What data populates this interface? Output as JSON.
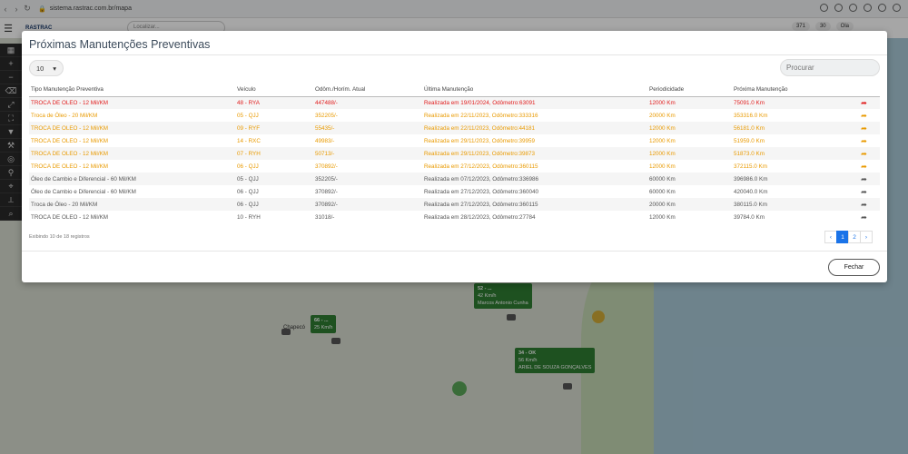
{
  "browser": {
    "url": "sistema.rastrac.com.br/mapa"
  },
  "header": {
    "logo": "RASTRAC",
    "search_placeholder": "Localizar...",
    "badges": [
      "371",
      "30",
      "Ola"
    ]
  },
  "map": {
    "markers": [
      {
        "plate": "52 - ...",
        "speed": "42 Km/h",
        "driver": "Marcos Antonio Cunha"
      },
      {
        "plate": "66 - ...",
        "speed": "25 Km/h",
        "driver": ""
      },
      {
        "plate": "34 - OK",
        "speed": "56 Km/h",
        "driver": "ARIEL DE SOUZA GONÇALVES"
      }
    ],
    "city_label": "Chapecó"
  },
  "modal": {
    "title": "Próximas Manutenções Preventivas",
    "page_size": "10",
    "search_placeholder": "Procurar",
    "columns": [
      "Tipo Manutenção Preventiva",
      "Veículo",
      "Odôm./Horím. Atual",
      "Última Manutenção",
      "Periodicidade",
      "Próxima Manutenção"
    ],
    "rows": [
      {
        "tipo": "TROCA DE OLEO - 12 Mil/KM",
        "veiculo": "48 - RYA",
        "odometro": "447488/-",
        "ultima": "Realizada em 19/01/2024, Odômetro:63091",
        "periodicidade": "12000 Km",
        "proxima": "75091.0 Km",
        "status": "red"
      },
      {
        "tipo": "Troca de Óleo - 20 Mil/KM",
        "veiculo": "05 - QJJ",
        "odometro": "352205/-",
        "ultima": "Realizada em 22/11/2023, Odômetro:333316",
        "periodicidade": "20000 Km",
        "proxima": "353316.0 Km",
        "status": "orange"
      },
      {
        "tipo": "TROCA DE OLEO - 12 Mil/KM",
        "veiculo": "09 - RYF",
        "odometro": "55435/-",
        "ultima": "Realizada em 22/11/2023, Odômetro:44181",
        "periodicidade": "12000 Km",
        "proxima": "56181.0 Km",
        "status": "orange"
      },
      {
        "tipo": "TROCA DE OLEO - 12 Mil/KM",
        "veiculo": "14 - RXC",
        "odometro": "49983/-",
        "ultima": "Realizada em 29/11/2023, Odômetro:39959",
        "periodicidade": "12000 Km",
        "proxima": "51959.0 Km",
        "status": "orange"
      },
      {
        "tipo": "TROCA DE OLEO - 12 Mil/KM",
        "veiculo": "07 - RYH",
        "odometro": "50713/-",
        "ultima": "Realizada em 29/11/2023, Odômetro:39873",
        "periodicidade": "12000 Km",
        "proxima": "51873.0 Km",
        "status": "orange"
      },
      {
        "tipo": "TROCA DE OLEO - 12 Mil/KM",
        "veiculo": "06 - QJJ",
        "odometro": "370892/-",
        "ultima": "Realizada em 27/12/2023, Odômetro:360115",
        "periodicidade": "12000 Km",
        "proxima": "372115.0 Km",
        "status": "orange"
      },
      {
        "tipo": "Óleo de Cambio e Diferencial - 60 Mil/KM",
        "veiculo": "05 - QJJ",
        "odometro": "352205/-",
        "ultima": "Realizada em 07/12/2023, Odômetro:336986",
        "periodicidade": "60000 Km",
        "proxima": "396986.0 Km",
        "status": "normal"
      },
      {
        "tipo": "Óleo de Cambio e Diferencial - 60 Mil/KM",
        "veiculo": "06 - QJJ",
        "odometro": "370892/-",
        "ultima": "Realizada em 27/12/2023, Odômetro:360040",
        "periodicidade": "60000 Km",
        "proxima": "420040.0 Km",
        "status": "normal"
      },
      {
        "tipo": "Troca de Óleo - 20 Mil/KM",
        "veiculo": "06 - QJJ",
        "odometro": "370892/-",
        "ultima": "Realizada em 27/12/2023, Odômetro:360115",
        "periodicidade": "20000 Km",
        "proxima": "380115.0 Km",
        "status": "normal"
      },
      {
        "tipo": "TROCA DE OLEO - 12 Mil/KM",
        "veiculo": "10 - RYH",
        "odometro": "31018/-",
        "ultima": "Realizada em 28/12/2023, Odômetro:27784",
        "periodicidade": "12000 Km",
        "proxima": "39784.0 Km",
        "status": "normal"
      }
    ],
    "info": "Exibindo 10 de 18 registros",
    "pagination": {
      "prev": "‹",
      "pages": [
        "1",
        "2"
      ],
      "next": "›"
    },
    "close_label": "Fechar",
    "colors": {
      "red": "#e11d1d",
      "orange": "#e99a00",
      "accent": "#1a73e8"
    }
  }
}
